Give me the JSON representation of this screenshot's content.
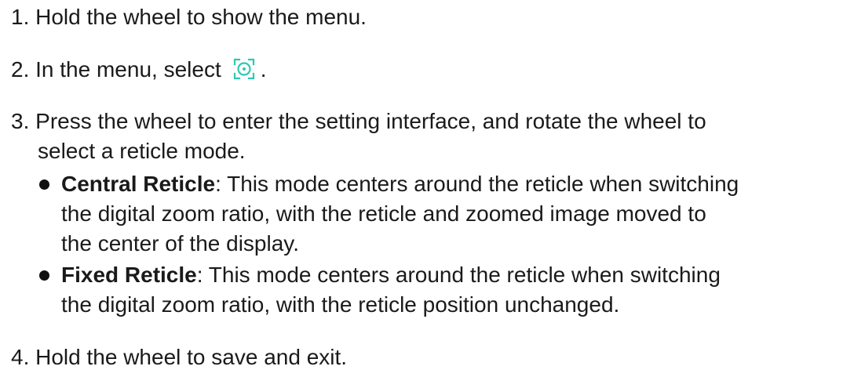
{
  "colors": {
    "text": "#1a1a1a",
    "icon_accent": "#2dc8b4"
  },
  "steps": [
    {
      "number": "1.",
      "text": "Hold the wheel to show the menu."
    },
    {
      "number": "2.",
      "text": "In the menu, select",
      "icon": "reticle-mode-icon",
      "suffix": "."
    },
    {
      "number": "3.",
      "text_line1": "Press the wheel to enter the setting interface, and rotate the wheel to",
      "text_line2": "select a reticle mode."
    },
    {
      "number": "4.",
      "text": "Hold the wheel to save and exit."
    }
  ],
  "reticle_modes": [
    {
      "term": "Central Reticle",
      "separator": ":",
      "line1": " This mode centers around the reticle when switching",
      "line2": "the digital zoom ratio, with the reticle and zoomed image moved to",
      "line3": "the center of the display."
    },
    {
      "term": "Fixed Reticle",
      "separator": ":",
      "line1": " This mode centers around the reticle when switching",
      "line2": "the digital zoom ratio, with the reticle position unchanged."
    }
  ]
}
